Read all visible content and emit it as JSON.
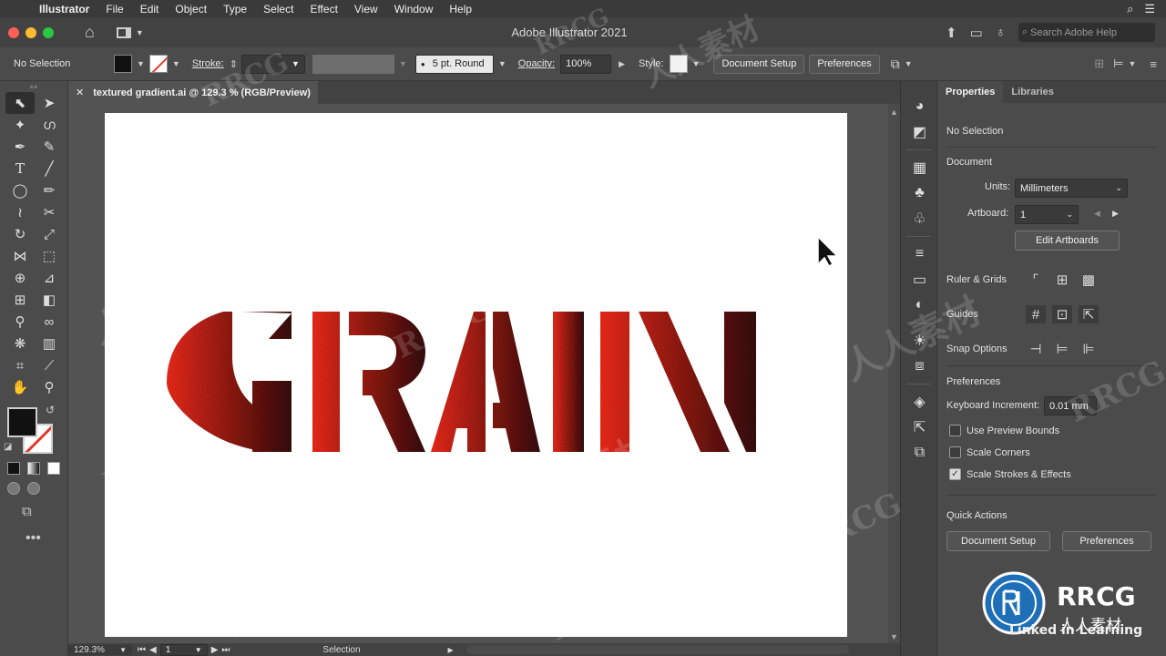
{
  "menubar": {
    "app": "Illustrator",
    "items": [
      "File",
      "Edit",
      "Object",
      "Type",
      "Select",
      "Effect",
      "View",
      "Window",
      "Help"
    ]
  },
  "titlebar": {
    "title": "Adobe Illustrator 2021",
    "search_placeholder": "Search Adobe Help"
  },
  "controlbar": {
    "selection": "No Selection",
    "stroke_label": "Stroke:",
    "brush": "5 pt. Round",
    "opacity_label": "Opacity:",
    "opacity_value": "100%",
    "style_label": "Style:",
    "document_setup": "Document Setup",
    "preferences": "Preferences"
  },
  "document": {
    "tab_title": "textured gradient.ai @ 129.3 % (RGB/Preview)",
    "artwork_text": "GRAIN",
    "gradient_colors": [
      "#ff2d1c",
      "#3a0c0c"
    ]
  },
  "statusbar": {
    "zoom": "129.3%",
    "artboard": "1",
    "tool": "Selection"
  },
  "properties": {
    "tabs": [
      "Properties",
      "Libraries"
    ],
    "selection": "No Selection",
    "document_heading": "Document",
    "units_label": "Units:",
    "units_value": "Millimeters",
    "artboard_label": "Artboard:",
    "artboard_value": "1",
    "edit_artboards": "Edit Artboards",
    "ruler_grids": "Ruler & Grids",
    "guides": "Guides",
    "snap_options": "Snap Options",
    "preferences_heading": "Preferences",
    "keyboard_increment_label": "Keyboard Increment:",
    "keyboard_increment_value": "0.01 mm",
    "checkboxes": [
      {
        "label": "Use Preview Bounds",
        "checked": false
      },
      {
        "label": "Scale Corners",
        "checked": false
      },
      {
        "label": "Scale Strokes & Effects",
        "checked": true
      }
    ],
    "quick_actions_heading": "Quick Actions",
    "quick_document_setup": "Document Setup",
    "quick_preferences": "Preferences"
  },
  "overlay": {
    "watermark_latin": "RRCG",
    "watermark_cjk": "人人素材",
    "brand": "RRCG",
    "brand_sub": "人人素材",
    "linkedin": "Linked in Learning"
  }
}
